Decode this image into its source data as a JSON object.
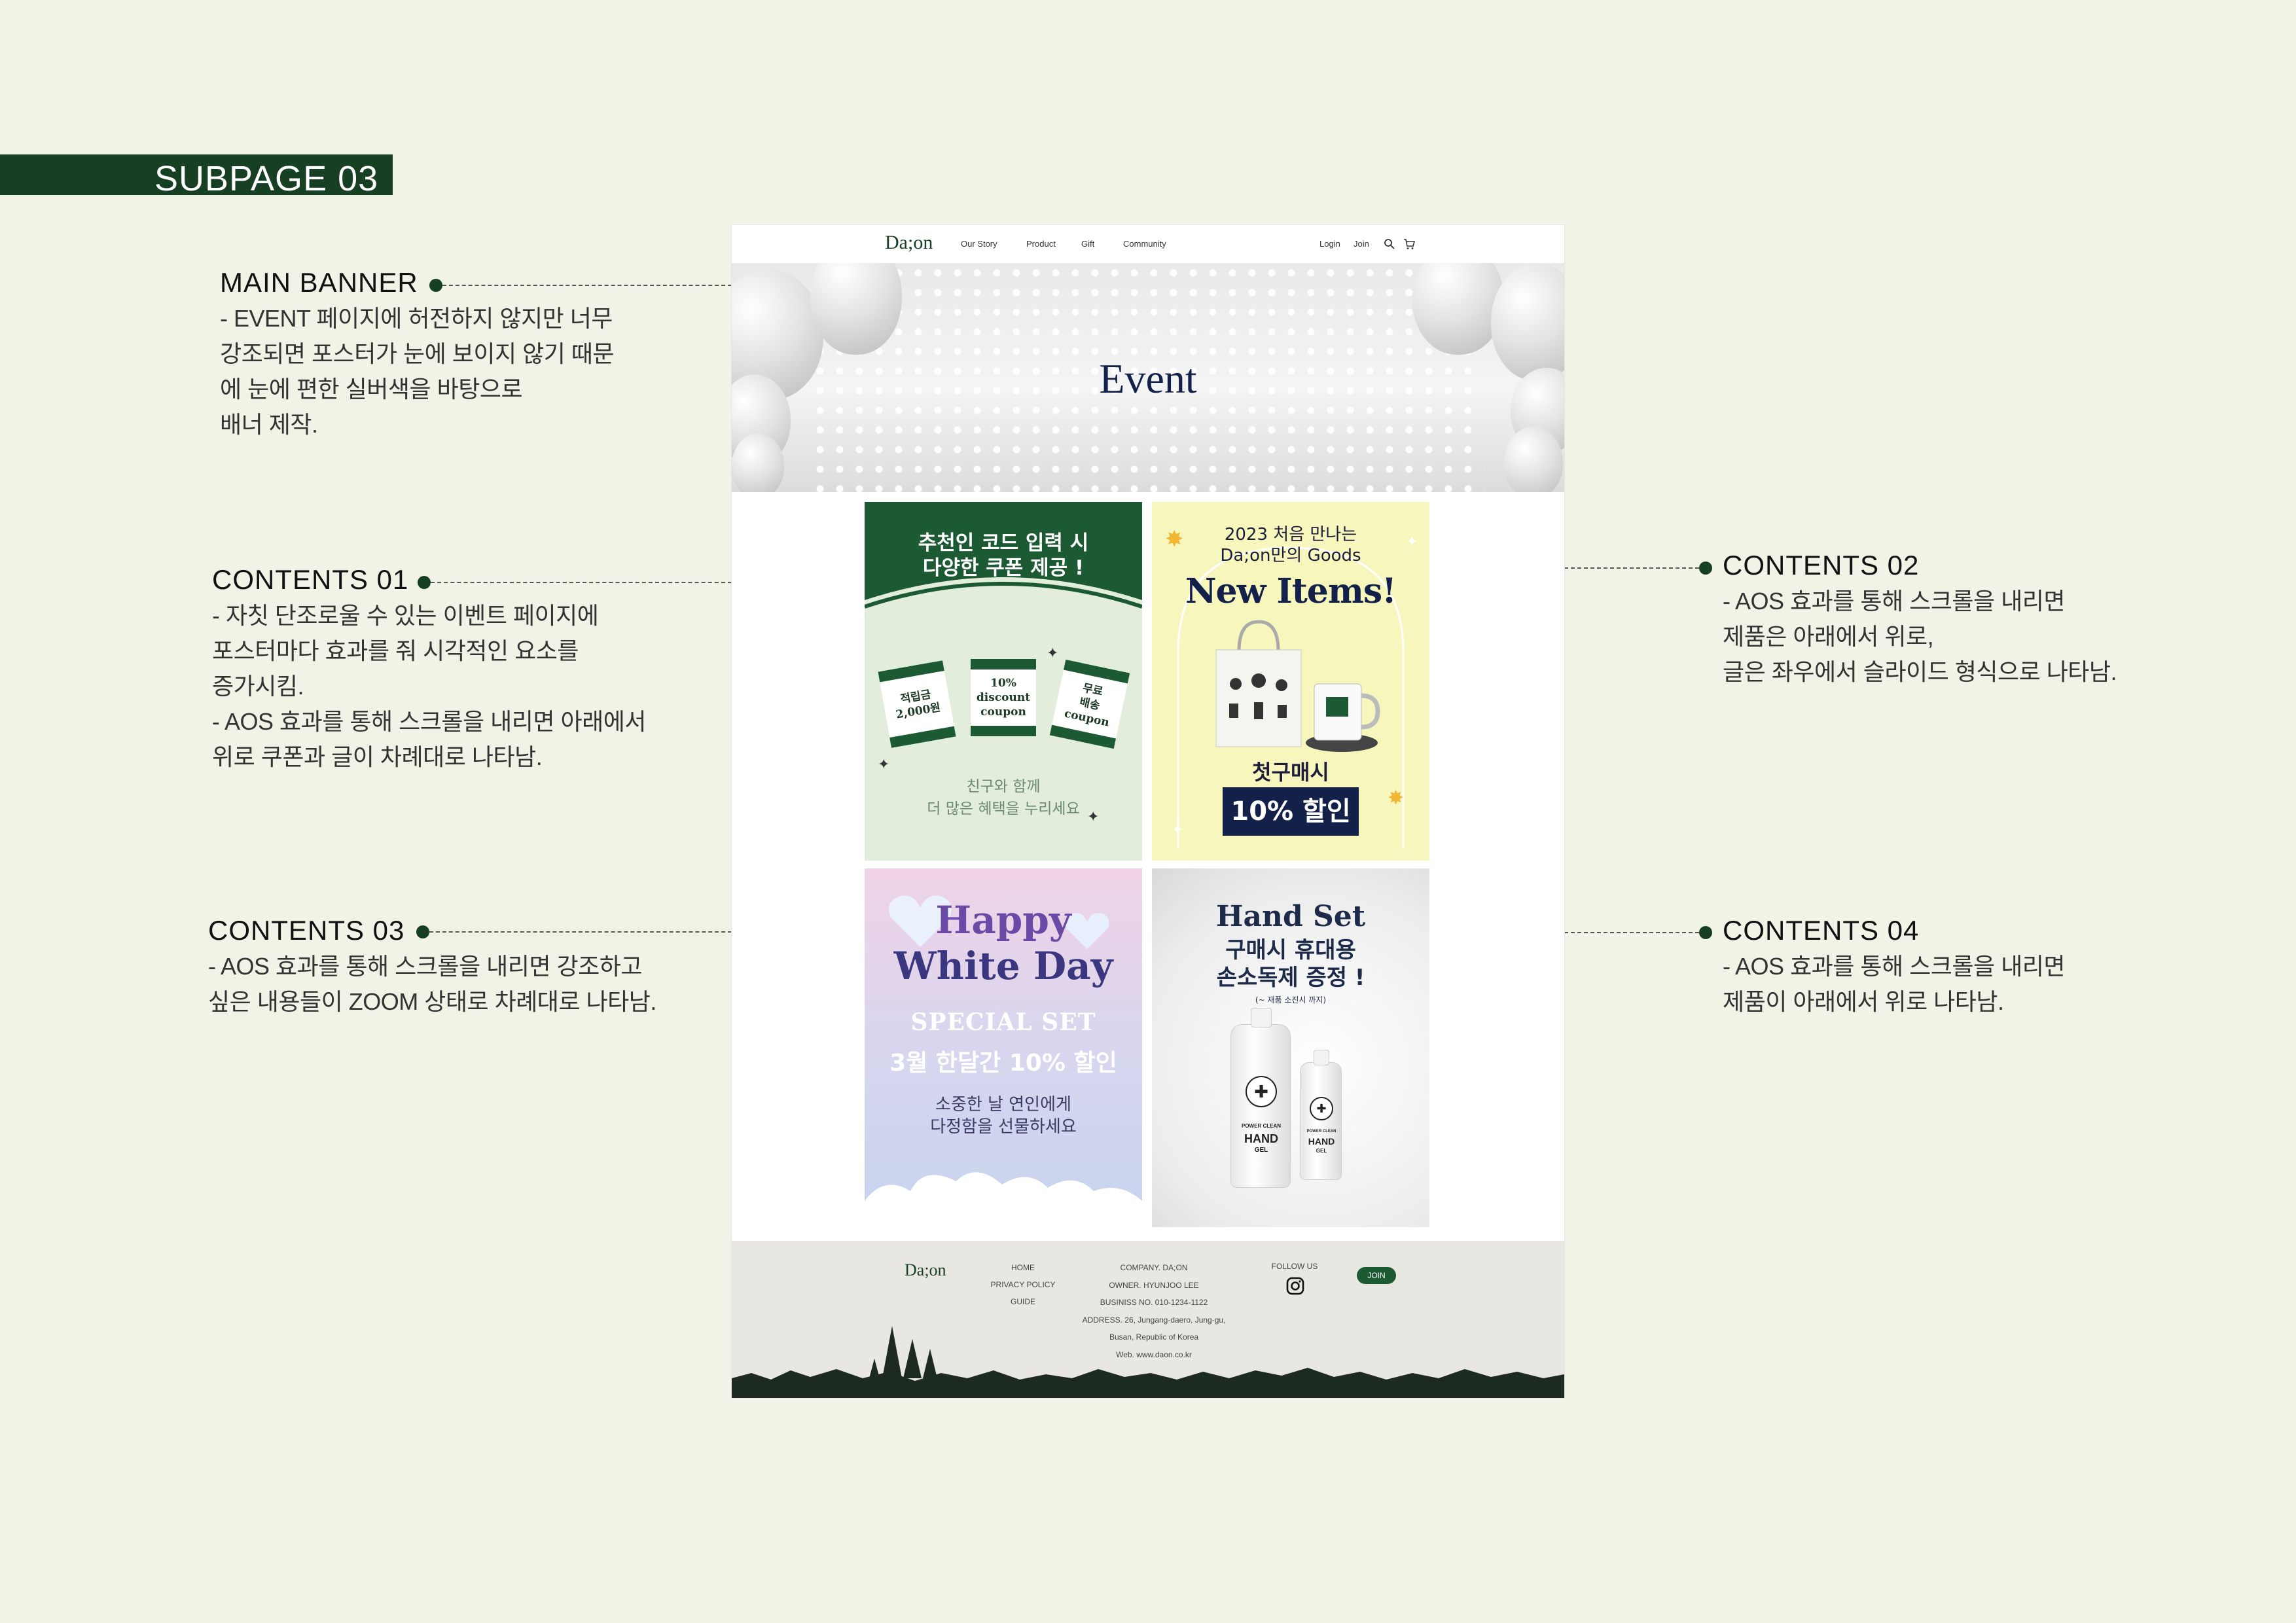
{
  "subpage": {
    "label": "SUBPAGE 03"
  },
  "annotations": {
    "main_banner": {
      "title": "MAIN BANNER",
      "lines": [
        "- EVENT 페이지에 허전하지 않지만 너무",
        "강조되면 포스터가 눈에 보이지 않기 때문",
        "에 눈에 편한 실버색을 바탕으로",
        "배너 제작."
      ]
    },
    "contents01": {
      "title": "CONTENTS 01",
      "lines": [
        "- 자칫 단조로울 수 있는 이벤트 페이지에",
        "포스터마다 효과를 줘 시각적인 요소를",
        "증가시킴.",
        "- AOS 효과를  통해 스크롤을 내리면 아래에서",
        "위로 쿠폰과 글이 차례대로 나타남."
      ]
    },
    "contents02": {
      "title": "CONTENTS 02",
      "lines": [
        "- AOS 효과를  통해 스크롤을 내리면",
        "제품은 아래에서 위로,",
        "글은 좌우에서 슬라이드 형식으로 나타남."
      ]
    },
    "contents03": {
      "title": "CONTENTS 03",
      "lines": [
        "- AOS 효과를  통해 스크롤을 내리면 강조하고",
        "싶은 내용들이 ZOOM 상태로 차례대로 나타남."
      ]
    },
    "contents04": {
      "title": "CONTENTS 04",
      "lines": [
        "- AOS 효과를  통해 스크롤을 내리면",
        "제품이 아래에서 위로 나타남."
      ]
    }
  },
  "site": {
    "logo": "Da;on",
    "nav": [
      "Our Story",
      "Product",
      "Gift",
      "Community"
    ],
    "nav_right": {
      "login": "Login",
      "join": "Join"
    },
    "banner": {
      "title": "Event"
    },
    "poster1": {
      "headline": [
        "추천인 코드 입력 시",
        "다양한 쿠폰 제공 !"
      ],
      "coupons": [
        "적립금\n2,000원",
        "10%\ndiscount\ncoupon",
        "무료\n배송\ncoupon"
      ],
      "footer": [
        "친구와 함께",
        "더 많은 혜택을 누리세요"
      ]
    },
    "poster2": {
      "sub": [
        "2023 처음 만나는",
        "Da;on만의 Goods"
      ],
      "title": "New Items!",
      "caption": "첫구매시",
      "badge": "10% 할인"
    },
    "poster3": {
      "title": [
        "Happy",
        "White Day"
      ],
      "special": "SPECIAL SET",
      "promo": "3월 한달간 10% 할인",
      "sub": [
        "소중한 날 연인에게",
        "다정함을 선물하세요"
      ]
    },
    "poster4": {
      "title": "Hand Set",
      "lines": [
        "구매시 휴대용",
        "손소독제 증정 !"
      ],
      "note": "(~ 재품 소진시 까지)",
      "bottle_label": [
        "POWER CLEAN",
        "HAND",
        "GEL"
      ]
    },
    "footer": {
      "links": [
        "HOME",
        "PRIVACY POLICY",
        "GUIDE"
      ],
      "company": [
        "COMPANY. DA;ON",
        "OWNER. HYUNJOO LEE",
        "BUSINISS NO. 010-1234-1122",
        "ADDRESS. 26, Jungang-daero, Jung-gu,",
        "Busan, Republic of Korea",
        "Web. www.daon.co.kr"
      ],
      "follow": "FOLLOW US",
      "join": "JOIN"
    }
  },
  "colors": {
    "brand_green": "#163f24",
    "page_bg": "#f1f3e7",
    "navy": "#12204a"
  }
}
